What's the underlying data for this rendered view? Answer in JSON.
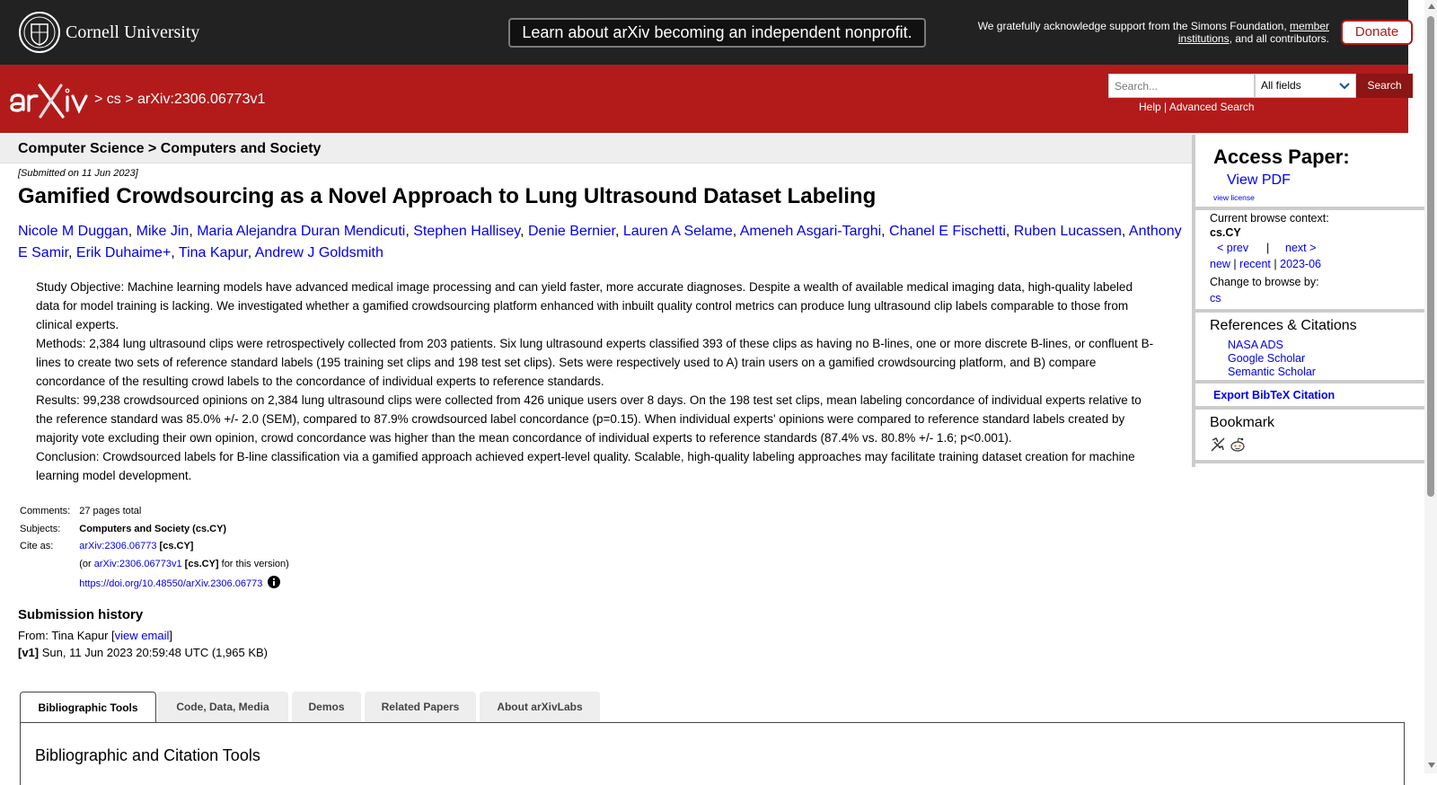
{
  "colors": {
    "brand_red": "#b31b1b",
    "top_bar": "#222222",
    "link": "#0000ee"
  },
  "top_bar": {
    "cornell_name": "Cornell University",
    "banner": "Learn about arXiv becoming an independent nonprofit.",
    "support_prefix": "We gratefully acknowledge support from the Simons Foundation, ",
    "support_link": "member institutions",
    "support_suffix": ", and all contributors.",
    "donate": "Donate"
  },
  "header": {
    "breadcrumb": {
      "sep1": " > ",
      "cs": "cs",
      "sep2": " > ",
      "id": "arXiv:2306.06773v1"
    },
    "search_placeholder": "Search...",
    "field": "All fields",
    "search_button": "Search",
    "help": "Help",
    "link_sep": " | ",
    "advanced": "Advanced Search"
  },
  "paper": {
    "subject_heading": "Computer Science > Computers and Society",
    "submitted": "[Submitted on 11 Jun 2023]",
    "title": "Gamified Crowdsourcing as a Novel Approach to Lung Ultrasound Dataset Labeling",
    "authors": [
      "Nicole M Duggan",
      "Mike Jin",
      "Maria Alejandra Duran Mendicuti",
      "Stephen Hallisey",
      "Denie Bernier",
      "Lauren A Selame",
      "Ameneh Asgari-Targhi",
      "Chanel E Fischetti",
      "Ruben Lucassen",
      "Anthony E Samir",
      "Erik Duhaime+",
      "Tina Kapur",
      "Andrew J Goldsmith"
    ],
    "abstract": [
      "Study Objective: Machine learning models have advanced medical image processing and can yield faster, more accurate diagnoses. Despite a wealth of available medical imaging data, high-quality labeled data for model training is lacking. We investigated whether a gamified crowdsourcing platform enhanced with inbuilt quality control metrics can produce lung ultrasound clip labels comparable to those from clinical experts.",
      "Methods: 2,384 lung ultrasound clips were retrospectively collected from 203 patients. Six lung ultrasound experts classified 393 of these clips as having no B-lines, one or more discrete B-lines, or confluent B-lines to create two sets of reference standard labels (195 training set clips and 198 test set clips). Sets were respectively used to A) train users on a gamified crowdsourcing platform, and B) compare concordance of the resulting crowd labels to the concordance of individual experts to reference standards.",
      "Results: 99,238 crowdsourced opinions on 2,384 lung ultrasound clips were collected from 426 unique users over 8 days. On the 198 test set clips, mean labeling concordance of individual experts relative to the reference standard was 85.0% +/- 2.0 (SEM), compared to 87.9% crowdsourced label concordance (p=0.15). When individual experts' opinions were compared to reference standard labels created by majority vote excluding their own opinion, crowd concordance was higher than the mean concordance of individual experts to reference standards (87.4% vs. 80.8% +/- 1.6; p<0.001).",
      "Conclusion: Crowdsourced labels for B-line classification via a gamified approach achieved expert-level quality. Scalable, high-quality labeling approaches may facilitate training dataset creation for machine learning model development."
    ],
    "meta": {
      "comments_label": "Comments:",
      "comments": "27 pages total",
      "subjects_label": "Subjects:",
      "subjects": "Computers and Society (cs.CY)",
      "cite_label": "Cite as:",
      "cite_id": "arXiv:2306.06773",
      "cite_tag": " [cs.CY]",
      "or_prefix": "(or ",
      "cite_version": "arXiv:2306.06773v1",
      "cite_version_tag": " [cs.CY]",
      "or_suffix": " for this version)",
      "doi": "https://doi.org/10.48550/arXiv.2306.06773"
    },
    "history": {
      "heading": "Submission history",
      "from_prefix": "From: Tina Kapur [",
      "view_email": "view email",
      "from_suffix": "]",
      "v1_label": "[v1]",
      "v1_text": " Sun, 11 Jun 2023 20:59:48 UTC (1,965 KB)"
    }
  },
  "tabs": {
    "items": [
      "Bibliographic Tools",
      "Code, Data, Media",
      "Demos",
      "Related Papers",
      "About arXivLabs"
    ],
    "panel_heading": "Bibliographic and Citation Tools"
  },
  "sidebar": {
    "access_heading": "Access Paper:",
    "view_pdf": "View PDF",
    "view_license": "view license",
    "context_label": "Current browse context:",
    "context": "cs.CY",
    "prev": "< prev",
    "pipe": "|",
    "next": "next >",
    "new": "new",
    "recent": "recent",
    "month": "2023-06",
    "change_label": "Change to browse by:",
    "browse_cs": "cs",
    "refs_heading": "References & Citations",
    "refs": [
      "NASA ADS",
      "Google Scholar",
      "Semantic Scholar"
    ],
    "export_bibtex": "Export BibTeX Citation",
    "bookmark_heading": "Bookmark",
    "bookmark_icons": [
      "bibsonomy-icon",
      "reddit-icon"
    ]
  }
}
